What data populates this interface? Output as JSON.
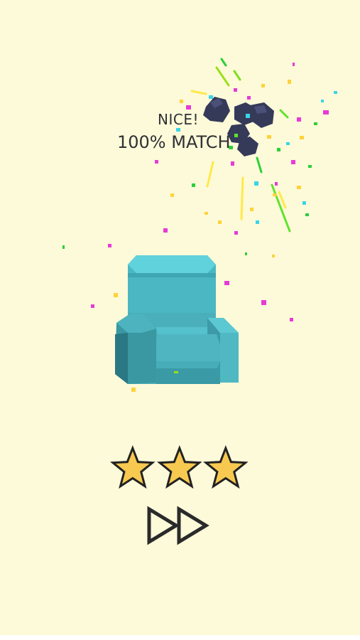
{
  "result": {
    "headline": "NICE!",
    "match_text": "100% MATCH"
  },
  "rating": {
    "stars_earned": 3,
    "stars_total": 3
  },
  "icons": {
    "model": "armchair-icon",
    "star": "star-icon",
    "skip": "fast-forward-icon",
    "effect": "smoke-puff-icon"
  },
  "colors": {
    "background": "#fdfad9",
    "text": "#2f3136",
    "star_fill": "#f7c950",
    "star_stroke": "#222222",
    "chair": "#4cb3bd",
    "smoke": "#353a59"
  }
}
